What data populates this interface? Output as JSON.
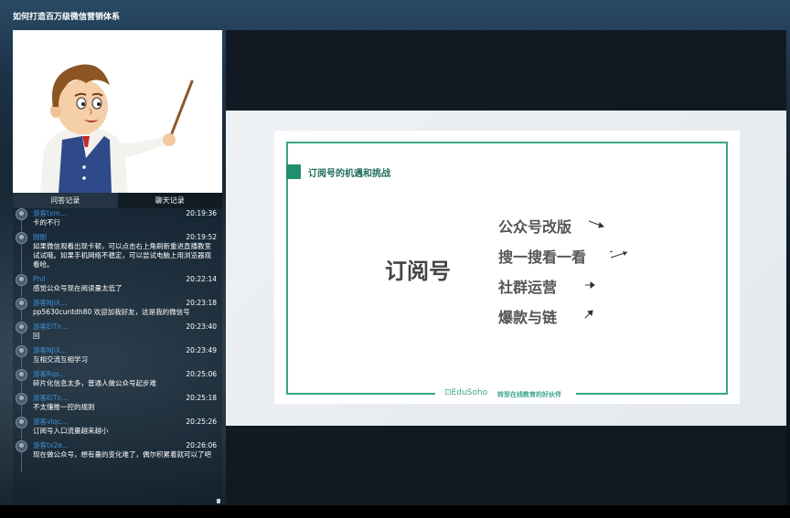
{
  "window": {
    "title": "如何打造百万级微信营销体系"
  },
  "tabs": [
    {
      "label": "问答记录",
      "active": true
    },
    {
      "label": "聊天记录",
      "active": false
    }
  ],
  "chat": [
    {
      "user": "游客txm...",
      "time": "20:19:36",
      "text": "卡的不行"
    },
    {
      "user": "刚刚",
      "time": "20:19:52",
      "text": "如果微信观看出现卡顿，可以点击右上角刷新重进直播教室试试哦。如果手机网络不稳定，可以尝试电脑上用浏览器观看哈。"
    },
    {
      "user": "Phil",
      "time": "20:22:14",
      "text": "感觉公众号现在阅读量太低了"
    },
    {
      "user": "游客NJiX...",
      "time": "20:23:18",
      "text": "pp5630cuntdh80 欢迎加我好友，这是我的微信号"
    },
    {
      "user": "游客ElTn...",
      "time": "20:23:40",
      "text": "回"
    },
    {
      "user": "游客NJiX...",
      "time": "20:23:49",
      "text": "互相交流互相学习"
    },
    {
      "user": "游客Rqs...",
      "time": "20:25:06",
      "text": "碎片化信息太多，普通人做公众号起步难"
    },
    {
      "user": "游客ElTn...",
      "time": "20:25:18",
      "text": "不太懂推一控的规则"
    },
    {
      "user": "游客viqc...",
      "time": "20:25:26",
      "text": "订阅号入口流量越来越小"
    },
    {
      "user": "游客tx2e...",
      "time": "20:26:06",
      "text": "现在做公众号，想有量的变化难了，偶尔积累着就可以了吧"
    }
  ],
  "slide": {
    "heading": "订阅号的机遇和挑战",
    "main_word": "订阅号",
    "items": [
      "公众号改版",
      "搜一搜看一看",
      "社群运营",
      "爆款与链"
    ],
    "logo": "EduSoho",
    "tagline": "转型在线教育的好伙伴"
  },
  "colors": {
    "accent": "#3aa58a",
    "name_link": "#3f8fd6",
    "heading": "#1f6e5a"
  },
  "icons": [
    "avatar-icon",
    "pointer-stick-icon",
    "arrow-icon"
  ]
}
